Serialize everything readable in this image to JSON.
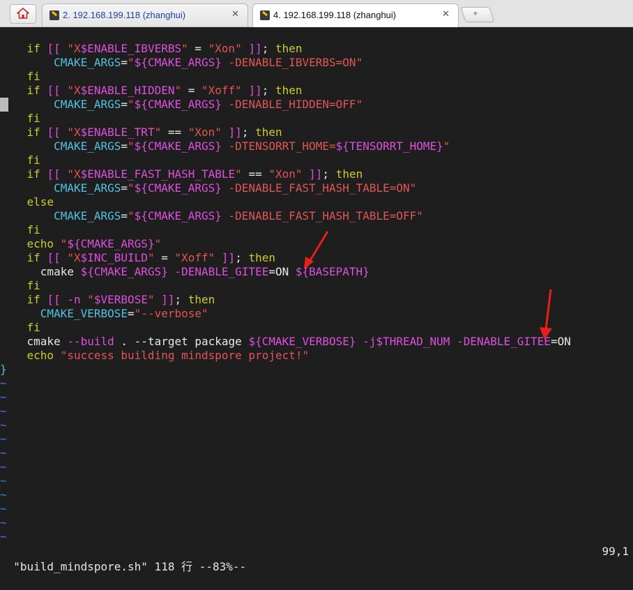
{
  "tabs": [
    {
      "label": "2. 192.168.199.118 (zhanghui)",
      "close": "✕"
    },
    {
      "label": "4. 192.168.199.118 (zhanghui)",
      "close": "✕"
    }
  ],
  "new_tab_symbol": "+",
  "code_lines": [
    [
      {
        "t": "    "
      },
      {
        "t": "if",
        "c": "k"
      },
      {
        "t": " "
      },
      {
        "t": "[[",
        "c": "m"
      },
      {
        "t": " "
      },
      {
        "t": "\"X",
        "c": "s"
      },
      {
        "t": "$ENABLE_IBVERBS",
        "c": "m"
      },
      {
        "t": "\"",
        "c": "s"
      },
      {
        "t": " = ",
        "c": "w"
      },
      {
        "t": "\"Xon\"",
        "c": "s"
      },
      {
        "t": " "
      },
      {
        "t": "]]",
        "c": "m"
      },
      {
        "t": "; "
      },
      {
        "t": "then",
        "c": "k"
      }
    ],
    [
      {
        "t": "        "
      },
      {
        "t": "CMAKE_ARGS",
        "c": "v"
      },
      {
        "t": "=",
        "c": "w"
      },
      {
        "t": "\"",
        "c": "s"
      },
      {
        "t": "${CMAKE_ARGS}",
        "c": "m"
      },
      {
        "t": " -DENABLE_IBVERBS=ON\"",
        "c": "s"
      }
    ],
    [
      {
        "t": "    "
      },
      {
        "t": "fi",
        "c": "k"
      }
    ],
    [
      {
        "t": "    "
      },
      {
        "t": "if",
        "c": "k"
      },
      {
        "t": " "
      },
      {
        "t": "[[",
        "c": "m"
      },
      {
        "t": " "
      },
      {
        "t": "\"X",
        "c": "s"
      },
      {
        "t": "$ENABLE_HIDDEN",
        "c": "m"
      },
      {
        "t": "\"",
        "c": "s"
      },
      {
        "t": " = ",
        "c": "w"
      },
      {
        "t": "\"Xoff\"",
        "c": "s"
      },
      {
        "t": " "
      },
      {
        "t": "]]",
        "c": "m"
      },
      {
        "t": "; "
      },
      {
        "t": "then",
        "c": "k"
      }
    ],
    [
      {
        "t": "        "
      },
      {
        "t": "CMAKE_ARGS",
        "c": "v"
      },
      {
        "t": "=",
        "c": "w"
      },
      {
        "t": "\"",
        "c": "s"
      },
      {
        "t": "${CMAKE_ARGS}",
        "c": "m"
      },
      {
        "t": " -DENABLE_HIDDEN=OFF\"",
        "c": "s"
      }
    ],
    [
      {
        "t": "    "
      },
      {
        "t": "fi",
        "c": "k"
      }
    ],
    [
      {
        "t": "    "
      },
      {
        "t": "if",
        "c": "k"
      },
      {
        "t": " "
      },
      {
        "t": "[[",
        "c": "m"
      },
      {
        "t": " "
      },
      {
        "t": "\"X",
        "c": "s"
      },
      {
        "t": "$ENABLE_TRT",
        "c": "m"
      },
      {
        "t": "\"",
        "c": "s"
      },
      {
        "t": " == ",
        "c": "w"
      },
      {
        "t": "\"Xon\"",
        "c": "s"
      },
      {
        "t": " "
      },
      {
        "t": "]]",
        "c": "m"
      },
      {
        "t": "; "
      },
      {
        "t": "then",
        "c": "k"
      }
    ],
    [
      {
        "t": "        "
      },
      {
        "t": "CMAKE_ARGS",
        "c": "v"
      },
      {
        "t": "=",
        "c": "w"
      },
      {
        "t": "\"",
        "c": "s"
      },
      {
        "t": "${CMAKE_ARGS}",
        "c": "m"
      },
      {
        "t": " -DTENSORRT_HOME=",
        "c": "s"
      },
      {
        "t": "${TENSORRT_HOME}",
        "c": "m"
      },
      {
        "t": "\"",
        "c": "s"
      }
    ],
    [
      {
        "t": "    "
      },
      {
        "t": "fi",
        "c": "k"
      }
    ],
    [
      {
        "t": "    "
      },
      {
        "t": "if",
        "c": "k"
      },
      {
        "t": " "
      },
      {
        "t": "[[",
        "c": "m"
      },
      {
        "t": " "
      },
      {
        "t": "\"X",
        "c": "s"
      },
      {
        "t": "$ENABLE_FAST_HASH_TABLE",
        "c": "m"
      },
      {
        "t": "\"",
        "c": "s"
      },
      {
        "t": " == ",
        "c": "w"
      },
      {
        "t": "\"Xon\"",
        "c": "s"
      },
      {
        "t": " "
      },
      {
        "t": "]]",
        "c": "m"
      },
      {
        "t": "; "
      },
      {
        "t": "then",
        "c": "k"
      }
    ],
    [
      {
        "t": "        "
      },
      {
        "t": "CMAKE_ARGS",
        "c": "v"
      },
      {
        "t": "=",
        "c": "w"
      },
      {
        "t": "\"",
        "c": "s"
      },
      {
        "t": "${CMAKE_ARGS}",
        "c": "m"
      },
      {
        "t": " -DENABLE_FAST_HASH_TABLE=ON\"",
        "c": "s"
      }
    ],
    [
      {
        "t": "    "
      },
      {
        "t": "else",
        "c": "k"
      }
    ],
    [
      {
        "t": "        "
      },
      {
        "t": "CMAKE_ARGS",
        "c": "v"
      },
      {
        "t": "=",
        "c": "w"
      },
      {
        "t": "\"",
        "c": "s"
      },
      {
        "t": "${CMAKE_ARGS}",
        "c": "m"
      },
      {
        "t": " -DENABLE_FAST_HASH_TABLE=OFF\"",
        "c": "s"
      }
    ],
    [
      {
        "t": "    "
      },
      {
        "t": "fi",
        "c": "k"
      }
    ],
    [
      {
        "t": "    "
      },
      {
        "t": "echo",
        "c": "k"
      },
      {
        "t": " "
      },
      {
        "t": "\"",
        "c": "s"
      },
      {
        "t": "${CMAKE_ARGS}",
        "c": "m"
      },
      {
        "t": "\"",
        "c": "s"
      }
    ],
    [
      {
        "t": "    "
      },
      {
        "t": "if",
        "c": "k"
      },
      {
        "t": " "
      },
      {
        "t": "[[",
        "c": "m"
      },
      {
        "t": " "
      },
      {
        "t": "\"X",
        "c": "s"
      },
      {
        "t": "$INC_BUILD",
        "c": "m"
      },
      {
        "t": "\"",
        "c": "s"
      },
      {
        "t": " = ",
        "c": "w"
      },
      {
        "t": "\"Xoff\"",
        "c": "s"
      },
      {
        "t": " "
      },
      {
        "t": "]]",
        "c": "m"
      },
      {
        "t": "; "
      },
      {
        "t": "then",
        "c": "k"
      }
    ],
    [
      {
        "t": "      "
      },
      {
        "t": "cmake ",
        "c": "w"
      },
      {
        "t": "${CMAKE_ARGS}",
        "c": "m"
      },
      {
        "t": " -DENABLE_GITEE",
        "c": "m"
      },
      {
        "t": "=ON ",
        "c": "w"
      },
      {
        "t": "${BASEPATH}",
        "c": "m"
      }
    ],
    [
      {
        "t": "    "
      },
      {
        "t": "fi",
        "c": "k"
      }
    ],
    [
      {
        "t": "    "
      },
      {
        "t": "if",
        "c": "k"
      },
      {
        "t": " "
      },
      {
        "t": "[[",
        "c": "m"
      },
      {
        "t": " "
      },
      {
        "t": "-n",
        "c": "m"
      },
      {
        "t": " "
      },
      {
        "t": "\"",
        "c": "s"
      },
      {
        "t": "$VERBOSE",
        "c": "m"
      },
      {
        "t": "\"",
        "c": "s"
      },
      {
        "t": " "
      },
      {
        "t": "]]",
        "c": "m"
      },
      {
        "t": "; "
      },
      {
        "t": "then",
        "c": "k"
      }
    ],
    [
      {
        "t": "      "
      },
      {
        "t": "CMAKE_VERBOSE",
        "c": "v"
      },
      {
        "t": "=",
        "c": "w"
      },
      {
        "t": "\"--verbose\"",
        "c": "s"
      }
    ],
    [
      {
        "t": "    "
      },
      {
        "t": "fi",
        "c": "k"
      }
    ],
    [
      {
        "t": "    "
      },
      {
        "t": "cmake",
        "c": "w"
      },
      {
        "t": " --build ",
        "c": "m"
      },
      {
        "t": ". --target package ",
        "c": "w"
      },
      {
        "t": "${CMAKE_VERBOSE}",
        "c": "m"
      },
      {
        "t": " -j",
        "c": "m"
      },
      {
        "t": "$THREAD_NUM",
        "c": "m"
      },
      {
        "t": " -DENABLE_GITEE",
        "c": "m"
      },
      {
        "t": "=ON",
        "c": "w"
      }
    ],
    [
      {
        "t": "    "
      },
      {
        "t": "echo",
        "c": "k"
      },
      {
        "t": " "
      },
      {
        "t": "\"success building mindspore project!\"",
        "c": "s"
      }
    ],
    [
      {
        "t": "}",
        "c": "v"
      }
    ]
  ],
  "tilde_count": 12,
  "tilde_char": "~",
  "status": {
    "file": "\"build_mindspore.sh\" 118 行 --83%--",
    "position": "99,1"
  },
  "colors": {
    "background": "#1e1e1e",
    "annotation_arrow": "#e8201a"
  }
}
